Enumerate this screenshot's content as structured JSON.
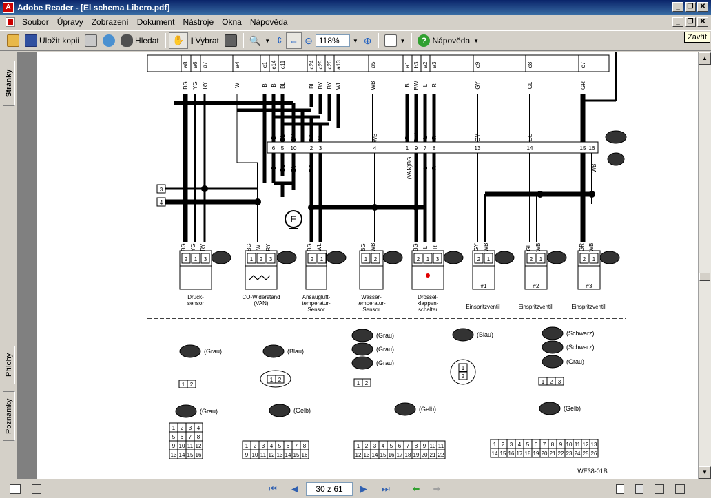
{
  "window": {
    "title": "Adobe Reader - [El schema Libero.pdf]",
    "app_icon": "A"
  },
  "menu": {
    "items": [
      "Soubor",
      "Úpravy",
      "Zobrazení",
      "Dokument",
      "Nástroje",
      "Okna",
      "Nápověda"
    ]
  },
  "toolbar": {
    "save_copy_label": "Uložit kopii",
    "find_label": "Hledat",
    "select_label": "Vybrat",
    "zoom_value": "118%",
    "help_label": "Nápověda",
    "close_tooltip": "Zavřít"
  },
  "sidebar": {
    "tab_pages": "Stránky",
    "tab_attachments": "Přílohy",
    "tab_comments": "Poznámky"
  },
  "status": {
    "page_indicator": "30 z 61"
  },
  "diagram": {
    "top_pins": [
      "a8",
      "a6",
      "a7",
      "a4",
      "c1",
      "c14",
      "c11",
      "c24",
      "c25",
      "c26",
      "a13",
      "a5",
      "a1",
      "b3",
      "a2",
      "a3",
      "c9",
      "c8",
      "c7"
    ],
    "top_wires": [
      "BG",
      "YG",
      "RY",
      "W",
      "B",
      "B",
      "BL",
      "BL",
      "BY",
      "BY",
      "WL",
      "WB",
      "B",
      "BW",
      "L",
      "R",
      "GY",
      "GL",
      "GR"
    ],
    "connector_nums": [
      "6",
      "5",
      "10",
      "2",
      "3",
      "4",
      "1",
      "9",
      "7",
      "8",
      "13",
      "14",
      "15",
      "16"
    ],
    "connector_wires_top": [
      "B",
      "BL",
      "BY",
      "BG",
      "WL",
      "WB",
      "B",
      "BW",
      "L",
      "R",
      "GY",
      "GL",
      "GR"
    ],
    "mid_wires": [
      "B",
      "BL",
      "BY",
      "BG",
      "(VAN)BG",
      "L",
      "R",
      "WB"
    ],
    "side_nums": [
      "3",
      "4"
    ],
    "ground_label": "E",
    "sensor_wires": {
      "druck": [
        "BG",
        "YG",
        "RY"
      ],
      "co": [
        "BG",
        "W",
        "RY"
      ],
      "ansaug": [
        "BG",
        "WL"
      ],
      "wasser": [
        "BG",
        "WB"
      ],
      "drossel": [
        "BG",
        "L",
        "R"
      ],
      "inj1": [
        "GY",
        "WB"
      ],
      "inj2": [
        "GL",
        "WB"
      ],
      "inj3": [
        "GR",
        "WB"
      ]
    },
    "sensor_pins": {
      "three": [
        "2",
        "1",
        "3"
      ],
      "co_three": [
        "1",
        "2",
        "3"
      ],
      "two": [
        "2",
        "1"
      ],
      "two_b": [
        "1",
        "2"
      ]
    },
    "sensor_labels": {
      "druck": [
        "Druck-",
        "sensor"
      ],
      "co": [
        "CO-Widerstand",
        "(VAN)"
      ],
      "ansaug": [
        "Ansaugluft-",
        "temperatur-",
        "Sensor"
      ],
      "wasser": [
        "Wasser-",
        "temperatur-",
        "Sensor"
      ],
      "drossel": [
        "Drossel-",
        "klappen-",
        "schalter"
      ],
      "inj1_num": "#1",
      "inj2_num": "#2",
      "inj3_num": "#3",
      "inj": "Einspritzventil"
    },
    "legend_colors": {
      "grau": "(Grau)",
      "blau": "(Blau)",
      "schwarz": "(Schwarz)",
      "gelb": "(Gelb)"
    },
    "connector_row1": [
      "1",
      "2",
      "3",
      "4",
      "5",
      "6",
      "7",
      "8",
      "9",
      "10",
      "11",
      "12",
      "13"
    ],
    "connector_row2": [
      "14",
      "15",
      "16",
      "17",
      "18",
      "19",
      "20",
      "21",
      "22",
      "23",
      "24",
      "25",
      "26"
    ],
    "small_pins": [
      "1",
      "2",
      "3"
    ],
    "figure_code": "WE38-01B"
  }
}
